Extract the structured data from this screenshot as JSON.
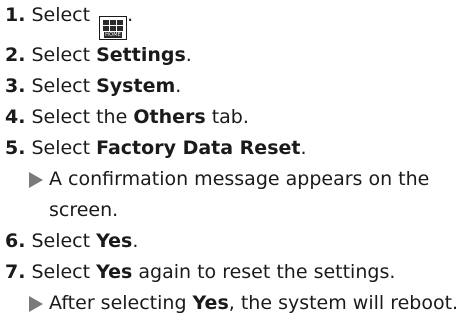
{
  "steps": [
    {
      "num": "1.",
      "pre": "Select ",
      "bold": "",
      "post": "."
    },
    {
      "num": "2.",
      "pre": "Select ",
      "bold": "Settings",
      "post": "."
    },
    {
      "num": "3.",
      "pre": "Select ",
      "bold": "System",
      "post": "."
    },
    {
      "num": "4.",
      "pre": "Select the ",
      "bold": "Others",
      "post": " tab."
    },
    {
      "num": "5.",
      "pre": "Select ",
      "bold": "Factory Data Reset",
      "post": "."
    },
    {
      "num": "6.",
      "pre": "Select ",
      "bold": "Yes",
      "post": "."
    },
    {
      "num": "7.",
      "pre": "Select ",
      "bold": "Yes",
      "post": " again to reset the settings."
    }
  ],
  "notes": {
    "step5": {
      "text": "A confirmation message appears on the screen."
    },
    "step7": {
      "pre": "After selecting ",
      "bold": "Yes",
      "post": ", the system will reboot."
    }
  },
  "home_icon": {
    "label": "HOME",
    "icon": "home-button-icon"
  },
  "colors": {
    "text": "#1a1a1a",
    "arrow": "#7a7a7a"
  }
}
